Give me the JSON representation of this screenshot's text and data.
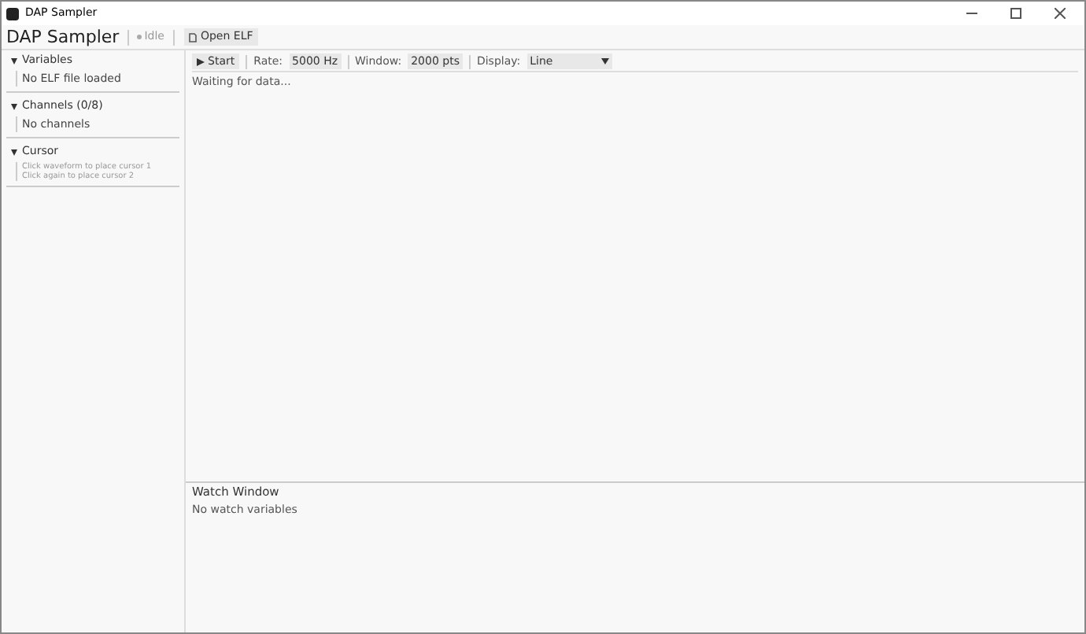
{
  "window": {
    "title": "DAP Sampler"
  },
  "header": {
    "app_name": "DAP Sampler",
    "status": "Idle",
    "open_button": "Open ELF"
  },
  "sidebar": {
    "sections": [
      {
        "title": "Variables",
        "expanded": true,
        "lines": [
          "No ELF file loaded"
        ],
        "kind": "normal"
      },
      {
        "title": "Channels (0/8)",
        "expanded": true,
        "lines": [
          "No channels"
        ],
        "kind": "normal"
      },
      {
        "title": "Cursor",
        "expanded": true,
        "lines": [
          "Click waveform to place cursor 1",
          "Click again to place cursor 2"
        ],
        "kind": "hint"
      }
    ]
  },
  "toolbar": {
    "start": "Start",
    "rate_label": "Rate:",
    "rate": "5000 Hz",
    "window_label": "Window:",
    "window": "2000 pts",
    "display_label": "Display:",
    "display": "Line"
  },
  "plot": {
    "message": "Waiting for data..."
  },
  "watch": {
    "title": "Watch Window",
    "message": "No watch variables"
  }
}
